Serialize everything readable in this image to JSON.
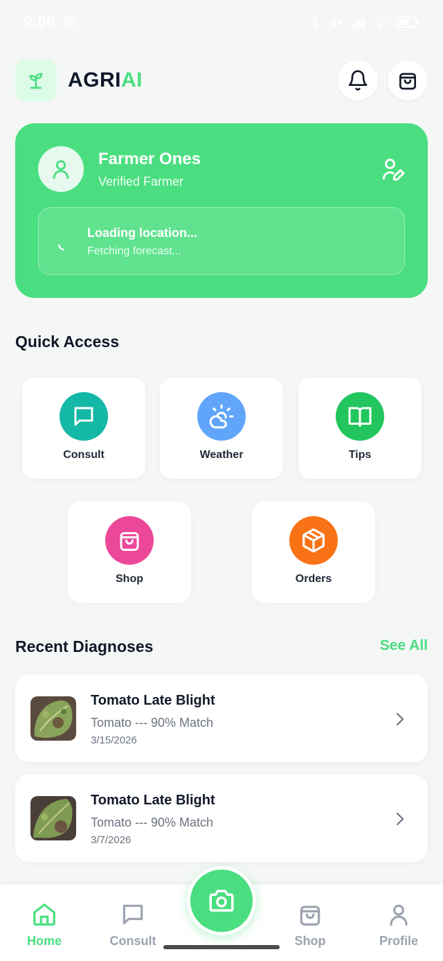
{
  "status_bar": {
    "time": "9:00"
  },
  "header": {
    "brand_part1": "AGRI",
    "brand_part2": "AI"
  },
  "profile": {
    "name": "Farmer Ones",
    "status": "Verified Farmer",
    "location_title": "Loading location...",
    "location_sub": "Fetching forecast..."
  },
  "quick_access": {
    "title": "Quick Access",
    "items": [
      {
        "label": "Consult",
        "color": "#14b8a6",
        "icon": "chat-icon"
      },
      {
        "label": "Weather",
        "color": "#60a5fa",
        "icon": "weather-icon"
      },
      {
        "label": "Tips",
        "color": "#22c55e",
        "icon": "book-icon"
      },
      {
        "label": "Shop",
        "color": "#ec4899",
        "icon": "bag-icon"
      },
      {
        "label": "Orders",
        "color": "#f97316",
        "icon": "box-icon"
      }
    ]
  },
  "recent": {
    "title": "Recent Diagnoses",
    "see_all": "See All",
    "items": [
      {
        "title": "Tomato Late Blight",
        "subtitle": "Tomato --- 90% Match",
        "date": "3/15/2026"
      },
      {
        "title": "Tomato Late Blight",
        "subtitle": "Tomato --- 90% Match",
        "date": "3/7/2026"
      }
    ]
  },
  "nav": {
    "home": "Home",
    "consult": "Consult",
    "shop": "Shop",
    "profile": "Profile"
  },
  "colors": {
    "accent": "#4ade80"
  }
}
